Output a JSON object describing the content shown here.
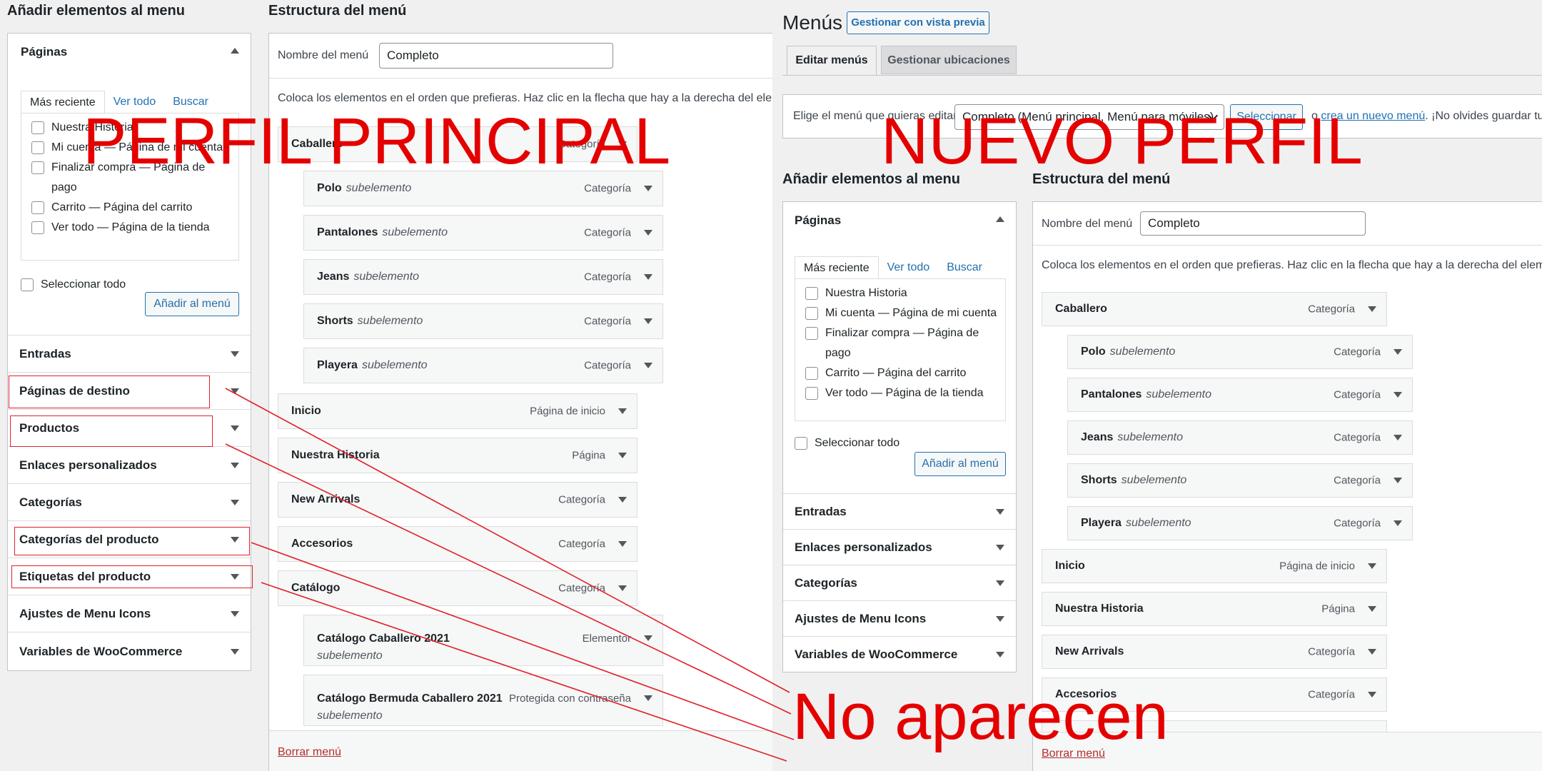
{
  "left": {
    "add_title": "Añadir elementos al menu",
    "structure_title": "Estructura del menú",
    "pages_label": "Páginas",
    "tabs": [
      "Más reciente",
      "Ver todo",
      "Buscar"
    ],
    "checks": [
      "Nuestra Historia",
      "Mi cuenta — Página de mi cuenta",
      "Finalizar compra — Página de pago",
      "Carrito — Página del carrito",
      "Ver todo — Página de la tienda"
    ],
    "select_all": "Seleccionar todo",
    "add_button": "Añadir al menú",
    "accordion": [
      "Entradas",
      "Páginas de destino",
      "Productos",
      "Enlaces personalizados",
      "Categorías",
      "Categorías del producto",
      "Etiquetas del producto",
      "Ajustes de Menu Icons",
      "Variables de WooCommerce"
    ],
    "menu_name_label": "Nombre del menú",
    "menu_name_value": "Completo",
    "instructions": "Coloca los elementos en el orden que prefieras. Haz clic en la flecha que hay a la derecha del elemento para mostrar más opciones de configuración.",
    "items": [
      {
        "name": "Caballero",
        "sub": "",
        "type": "Categoría"
      },
      {
        "name": "Polo",
        "sub": "subelemento",
        "type": "Categoría"
      },
      {
        "name": "Pantalones",
        "sub": "subelemento",
        "type": "Categoría"
      },
      {
        "name": "Jeans",
        "sub": "subelemento",
        "type": "Categoría"
      },
      {
        "name": "Shorts",
        "sub": "subelemento",
        "type": "Categoría"
      },
      {
        "name": "Playera",
        "sub": "subelemento",
        "type": "Categoría"
      },
      {
        "name": "Inicio",
        "sub": "",
        "type": "Página de inicio"
      },
      {
        "name": "Nuestra Historia",
        "sub": "",
        "type": "Página"
      },
      {
        "name": "New Arrivals",
        "sub": "",
        "type": "Categoría"
      },
      {
        "name": "Accesorios",
        "sub": "",
        "type": "Categoría"
      },
      {
        "name": "Catálogo",
        "sub": "",
        "type": "Categoría"
      },
      {
        "name": "Catálogo Caballero 2021",
        "sub": "subelemento",
        "type": "Elementor"
      },
      {
        "name": "Catálogo Bermuda Caballero 2021",
        "sub": "subelemento",
        "type": "Protegida con contraseña"
      }
    ],
    "delete_menu": "Borrar menú"
  },
  "right": {
    "page_title": "Menús",
    "preview_button": "Gestionar con vista previa",
    "tab_edit": "Editar menús",
    "tab_locations": "Gestionar ubicaciones",
    "select_prompt": "Elige el menú que quieras editar:",
    "select_value": "Completo (Menú principal, Menú para móviles)",
    "select_button": "Seleccionar",
    "or_text": "o",
    "create_link": "crea un nuevo menú",
    "save_note": ". ¡No olvides guardar tus cambios!",
    "add_title": "Añadir elementos al menu",
    "structure_title": "Estructura del menú",
    "pages_label": "Páginas",
    "tabs": [
      "Más reciente",
      "Ver todo",
      "Buscar"
    ],
    "checks": [
      "Nuestra Historia",
      "Mi cuenta — Página de mi cuenta",
      "Finalizar compra — Página de pago",
      "Carrito — Página del carrito",
      "Ver todo — Página de la tienda"
    ],
    "select_all": "Seleccionar todo",
    "add_button": "Añadir al menú",
    "accordion": [
      "Entradas",
      "Enlaces personalizados",
      "Categorías",
      "Ajustes de Menu Icons",
      "Variables de WooCommerce"
    ],
    "menu_name_label": "Nombre del menú",
    "menu_name_value": "Completo",
    "instructions": "Coloca los elementos en el orden que prefieras. Haz clic en la flecha que hay a la derecha del elemento para mostrar más opciones de configuración.",
    "items": [
      {
        "name": "Caballero",
        "sub": "",
        "type": "Categoría"
      },
      {
        "name": "Polo",
        "sub": "subelemento",
        "type": "Categoría"
      },
      {
        "name": "Pantalones",
        "sub": "subelemento",
        "type": "Categoría"
      },
      {
        "name": "Jeans",
        "sub": "subelemento",
        "type": "Categoría"
      },
      {
        "name": "Shorts",
        "sub": "subelemento",
        "type": "Categoría"
      },
      {
        "name": "Playera",
        "sub": "subelemento",
        "type": "Categoría"
      },
      {
        "name": "Inicio",
        "sub": "",
        "type": "Página de inicio"
      },
      {
        "name": "Nuestra Historia",
        "sub": "",
        "type": "Página"
      },
      {
        "name": "New Arrivals",
        "sub": "",
        "type": "Categoría"
      },
      {
        "name": "Accesorios",
        "sub": "",
        "type": "Categoría"
      }
    ],
    "delete_menu": "Borrar menú"
  },
  "annotations": {
    "left_label": "PERFIL PRINCIPAL",
    "right_label": "NUEVO PERFIL",
    "missing_label": "No aparecen",
    "color": "#e50000"
  }
}
